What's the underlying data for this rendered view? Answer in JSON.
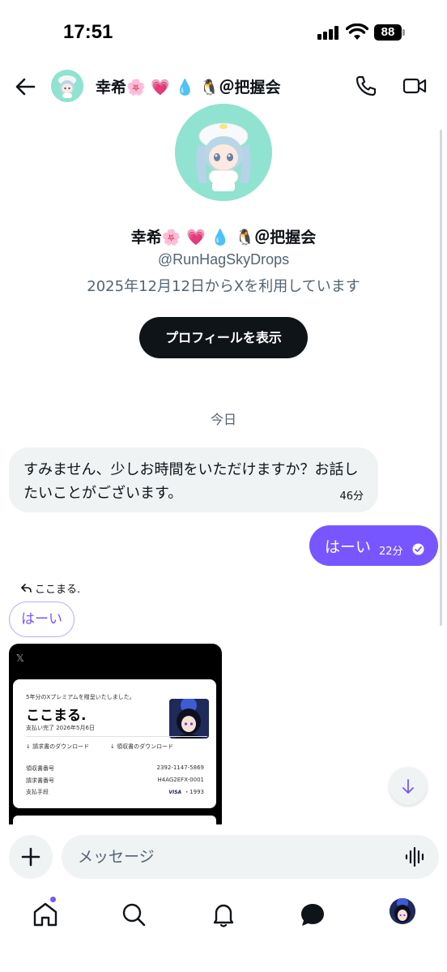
{
  "status_bar": {
    "time": "17:51",
    "battery": "88"
  },
  "header": {
    "title": "幸希🌸 💗 💧 🐧＠把握会",
    "icons": {
      "back": "arrow-left-icon",
      "call": "phone-icon",
      "video": "video-camera-icon"
    }
  },
  "profile": {
    "name": "幸希🌸 💗 💧 🐧＠把握会",
    "handle": "@RunHagSkyDrops",
    "joined": "2025年12月12日からXを利用しています",
    "view_profile_label": "プロフィールを表示"
  },
  "conversation": {
    "date_divider": "今日",
    "messages": [
      {
        "direction": "incoming",
        "text": "すみません、少しお時間をいただけますか？お話したいことがございます。",
        "time": "46分"
      },
      {
        "direction": "outgoing",
        "text": "はーい",
        "time": "22分",
        "status": "read"
      }
    ],
    "reply": {
      "label": "ここまる.",
      "quoted_text": "はーい"
    },
    "attachment": {
      "logo": "𝕏",
      "receipt": {
        "subtitle": "5年分のXプレミアムを贈呈いたしました。",
        "title": "ここまる.",
        "meta": "支払い完了 2026年5月6日",
        "download_1": "↓ 請求書のダウンロード",
        "download_2": "↓ 領収書のダウンロード",
        "rows": [
          {
            "label": "領収書番号",
            "value": "2392-1147-5869"
          },
          {
            "label": "請求書番号",
            "value": "H4AG2EFX-0001"
          },
          {
            "label": "支払手段",
            "card": "VISA",
            "value": "・1993"
          }
        ]
      }
    }
  },
  "composer": {
    "placeholder": "メッセージ"
  },
  "nav": {
    "items": [
      "home-icon",
      "search-icon",
      "bell-icon",
      "messages-icon",
      "profile-avatar"
    ],
    "active": "messages-icon"
  },
  "colors": {
    "accent": "#7856ff",
    "bubble_in": "#eff3f4",
    "text": "#0f1419",
    "muted": "#536471",
    "avatar_bg": "#8fe3d0"
  }
}
